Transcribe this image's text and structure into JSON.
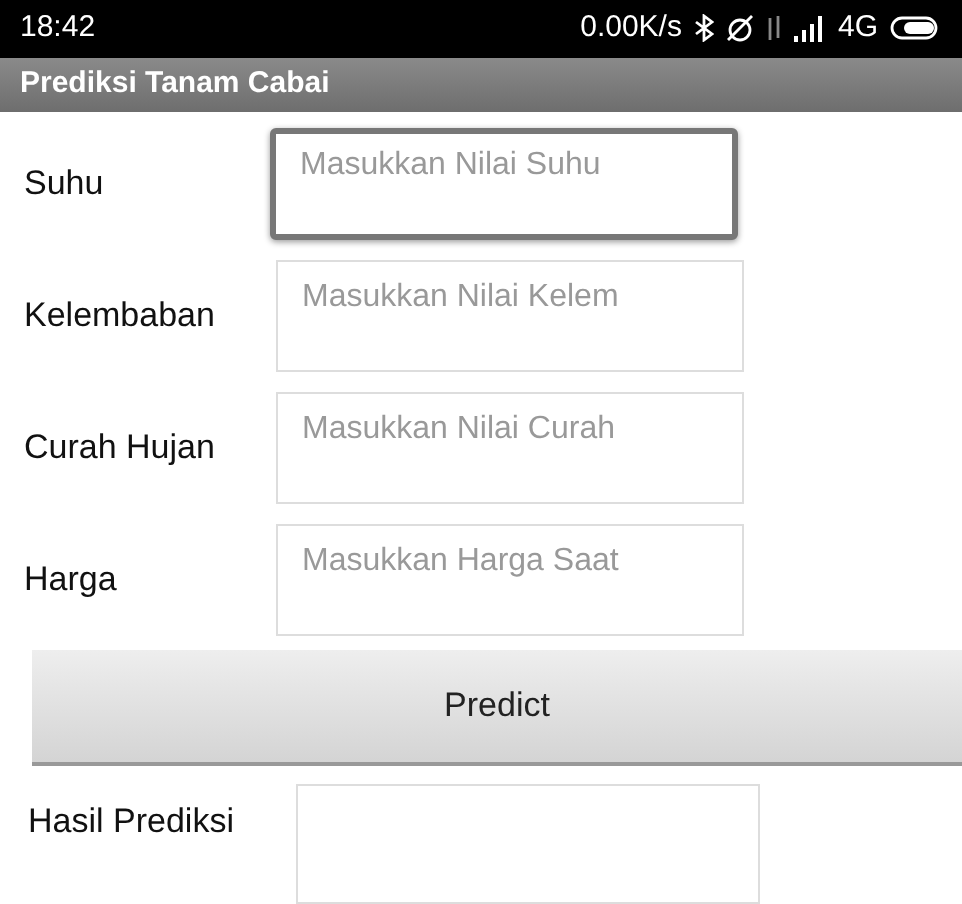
{
  "status_bar": {
    "time": "18:42",
    "speed": "0.00K/s",
    "network": "4G"
  },
  "app_bar": {
    "title": "Prediksi Tanam Cabai"
  },
  "fields": [
    {
      "label": "Suhu",
      "placeholder": "Masukkan Nilai Suhu",
      "focused": true
    },
    {
      "label": "Kelembaban",
      "placeholder": "Masukkan Nilai Kelem",
      "focused": false
    },
    {
      "label": "Curah Hujan",
      "placeholder": "Masukkan Nilai Curah",
      "focused": false
    },
    {
      "label": "Harga",
      "placeholder": "Masukkan Harga Saat",
      "focused": false
    }
  ],
  "predict_button": {
    "label": "Predict"
  },
  "result": {
    "label": "Hasil Prediksi"
  }
}
